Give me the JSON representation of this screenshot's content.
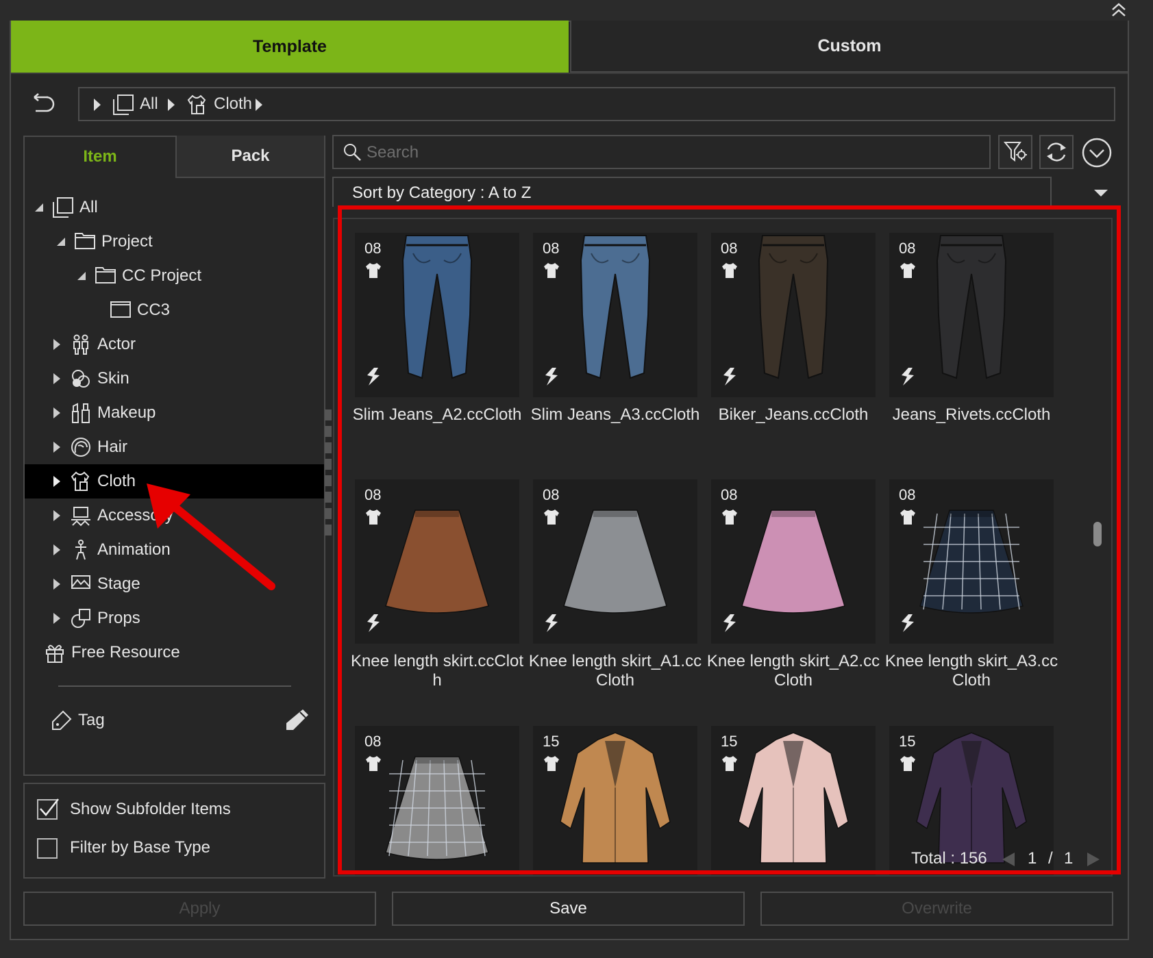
{
  "tabs": {
    "template": "Template",
    "custom": "Custom"
  },
  "breadcrumb": {
    "all": "All",
    "cloth": "Cloth"
  },
  "subtabs": {
    "item": "Item",
    "pack": "Pack"
  },
  "tree": {
    "all": "All",
    "project": "Project",
    "cc_project": "CC Project",
    "cc3": "CC3",
    "actor": "Actor",
    "skin": "Skin",
    "makeup": "Makeup",
    "hair": "Hair",
    "cloth": "Cloth",
    "accessory": "Accessory",
    "animation": "Animation",
    "stage": "Stage",
    "props": "Props",
    "free_resource": "Free Resource",
    "tag": "Tag"
  },
  "options": {
    "show_subfolder": {
      "label": "Show Subfolder Items",
      "checked": true
    },
    "filter_base": {
      "label": "Filter by Base Type",
      "checked": false
    }
  },
  "search": {
    "placeholder": "Search"
  },
  "sort": {
    "label": "Sort by Category : A to Z"
  },
  "items": [
    {
      "badge": "08",
      "label": "Slim Jeans_A2.ccCloth",
      "kind": "jeans",
      "color": "#3b5e88"
    },
    {
      "badge": "08",
      "label": "Slim Jeans_A3.ccCloth",
      "kind": "jeans",
      "color": "#4c6d92"
    },
    {
      "badge": "08",
      "label": "Biker_Jeans.ccCloth",
      "kind": "jeans",
      "color": "#3a3128"
    },
    {
      "badge": "08",
      "label": "Jeans_Rivets.ccCloth",
      "kind": "jeans",
      "color": "#2d2d2f"
    },
    {
      "badge": "08",
      "label": "Knee length skirt.ccCloth",
      "kind": "skirt",
      "color": "#8a5030"
    },
    {
      "badge": "08",
      "label": "Knee length skirt_A1.ccCloth",
      "kind": "skirt",
      "color": "#8c8f93"
    },
    {
      "badge": "08",
      "label": "Knee length skirt_A2.ccCloth",
      "kind": "skirt",
      "color": "#cc90b4"
    },
    {
      "badge": "08",
      "label": "Knee length skirt_A3.ccCloth",
      "kind": "skirt-plaid",
      "color": "#1f2a3a"
    },
    {
      "badge": "08",
      "label": "",
      "kind": "skirt-plaid",
      "color": "#8a8a8a"
    },
    {
      "badge": "15",
      "label": "",
      "kind": "coat",
      "color": "#c08850"
    },
    {
      "badge": "15",
      "label": "",
      "kind": "coat",
      "color": "#e6c2bc"
    },
    {
      "badge": "15",
      "label": "",
      "kind": "coat",
      "color": "#3e2e4e"
    }
  ],
  "pagination": {
    "total": "Total : 156",
    "current": "1",
    "sep": "/",
    "pages": "1"
  },
  "buttons": {
    "apply": "Apply",
    "save": "Save",
    "overwrite": "Overwrite"
  },
  "colors": {
    "accent": "#7cb518",
    "highlight": "#e60000"
  }
}
